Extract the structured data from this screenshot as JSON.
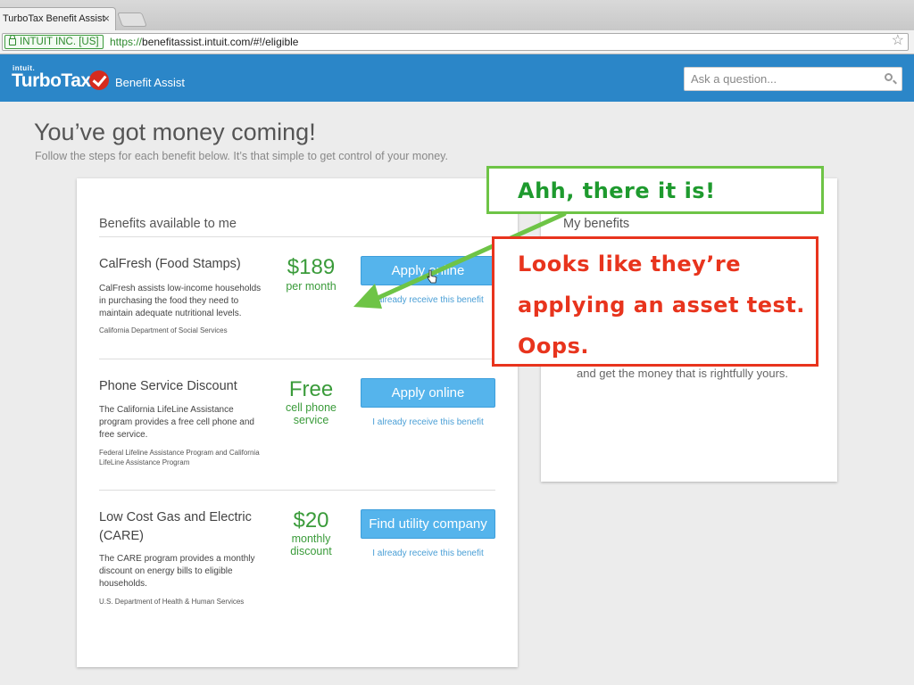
{
  "browser": {
    "tab_title": "TurboTax Benefit Assist",
    "tab_close": "×",
    "ev_cert": "INTUIT INC. [US]",
    "url_scheme": "https://",
    "url_rest": "benefitassist.intuit.com/#!/eligible"
  },
  "header": {
    "logo_small": "intuit.",
    "logo_main": "TurboTax",
    "logo_product": "Benefit Assist",
    "search_placeholder": "Ask a question..."
  },
  "page": {
    "headline": "You’ve got money coming!",
    "subhead": "Follow the steps for each benefit below. It’s that simple to get control of your money."
  },
  "available": {
    "title": "Benefits available to me",
    "benefits": [
      {
        "name": "CalFresh (Food Stamps)",
        "description": "CalFresh assists low-income households in purchasing the food they need to maintain adequate nutritional levels.",
        "agency": "California Department of Social Services",
        "amount": "$189",
        "period": "per month",
        "button": "Apply online",
        "link": "I already receive this benefit"
      },
      {
        "name": "Phone Service Discount",
        "description": "The California LifeLine Assistance program provides a free cell phone and free service.",
        "agency": "Federal Lifeline Assistance Program and California LifeLine Assistance Program",
        "amount": "Free",
        "period": "cell phone service",
        "button": "Apply online",
        "link": "I already receive this benefit"
      },
      {
        "name": "Low Cost Gas and Electric (CARE)",
        "description": "The CARE program provides a monthly discount on energy bills to eligible households.",
        "agency": "U.S. Department of Health & Human Services",
        "amount": "$20",
        "period": "monthly discount",
        "button": "Find utility company",
        "link": "I already receive this benefit"
      }
    ]
  },
  "my_benefits": {
    "title": "My benefits",
    "text": "and get the money that is rightfully yours."
  },
  "annotations": {
    "green": "Ahh, there it is!",
    "red_lines": [
      "Looks like they’re",
      "applying an asset test.",
      "Oops."
    ],
    "colors": {
      "green": "#6ec446",
      "red": "#e8341d"
    }
  }
}
